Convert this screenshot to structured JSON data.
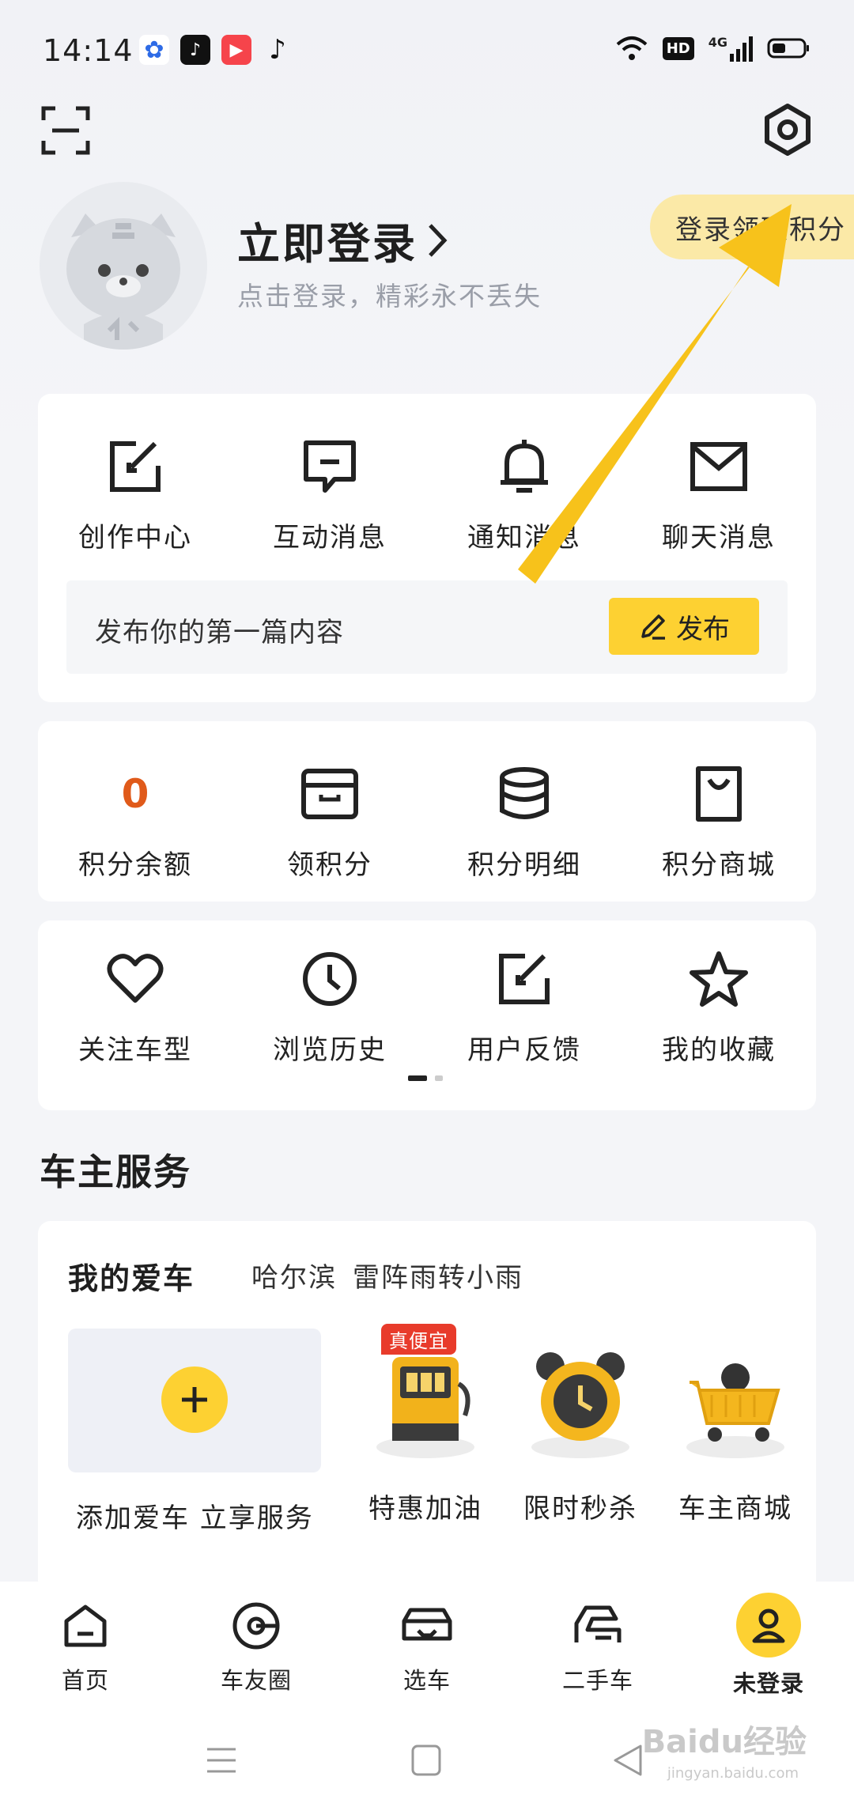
{
  "status_bar": {
    "time": "14:14",
    "network": "4G",
    "hd": "HD"
  },
  "profile": {
    "login_title": "立即登录",
    "login_subtitle": "点击登录，精彩永不丢失",
    "points_banner": "登录领取积分"
  },
  "messages": {
    "items": [
      {
        "label": "创作中心",
        "icon": "edit-icon"
      },
      {
        "label": "互动消息",
        "icon": "chat-icon"
      },
      {
        "label": "通知消息",
        "icon": "bell-icon"
      },
      {
        "label": "聊天消息",
        "icon": "mail-icon"
      }
    ],
    "publish_prompt": "发布你的第一篇内容",
    "publish_button": "发布"
  },
  "points": {
    "balance": "0",
    "items": [
      {
        "label": "积分余额"
      },
      {
        "label": "领积分",
        "icon": "box-icon"
      },
      {
        "label": "积分明细",
        "icon": "database-icon"
      },
      {
        "label": "积分商城",
        "icon": "shopping-bag-icon"
      }
    ]
  },
  "tools": {
    "items": [
      {
        "label": "关注车型",
        "icon": "heart-icon"
      },
      {
        "label": "浏览历史",
        "icon": "clock-icon"
      },
      {
        "label": "用户反馈",
        "icon": "feedback-icon"
      },
      {
        "label": "我的收藏",
        "icon": "star-icon"
      }
    ]
  },
  "owner_service": {
    "section_title": "车主服务",
    "my_car_title": "我的爱车",
    "city": "哈尔滨",
    "weather": "雷阵雨转小雨",
    "add_car_label": "添加爱车 立享服务",
    "services": [
      {
        "label": "特惠加油",
        "badge": "真便宜",
        "icon": "fuel-pump-icon"
      },
      {
        "label": "限时秒杀",
        "icon": "alarm-clock-icon"
      },
      {
        "label": "车主商城",
        "icon": "shopping-cart-icon"
      }
    ]
  },
  "bottom_nav": {
    "items": [
      {
        "label": "首页",
        "icon": "home-icon"
      },
      {
        "label": "车友圈",
        "icon": "circle-icon"
      },
      {
        "label": "选车",
        "icon": "car-icon"
      },
      {
        "label": "二手车",
        "icon": "used-car-icon"
      },
      {
        "label": "未登录",
        "icon": "user-icon",
        "active": true
      }
    ]
  },
  "watermark": {
    "brand": "Baidu经验",
    "url": "jingyan.baidu.com"
  },
  "colors": {
    "accent": "#fdd132",
    "points_zero": "#e05a1a",
    "badge_red": "#e83b2b",
    "arrow": "#f7c21b"
  }
}
